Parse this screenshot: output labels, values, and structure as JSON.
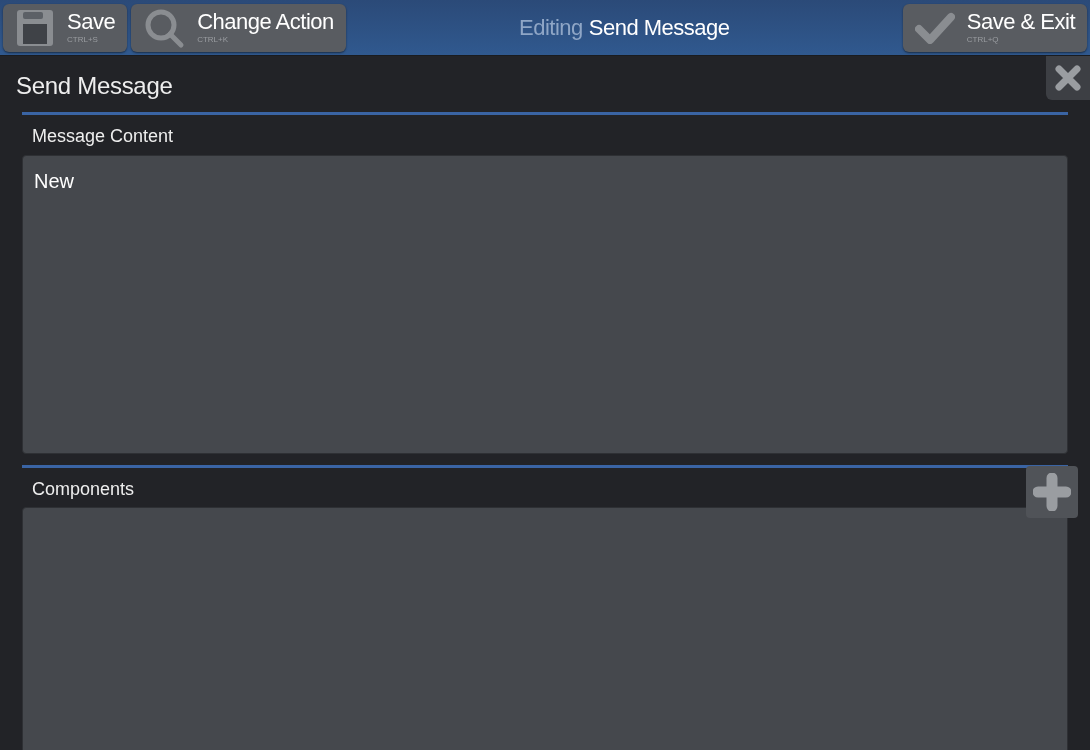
{
  "toolbar": {
    "buttons": [
      {
        "kind": "save",
        "label": "Save",
        "shortcut": "CTRL+S"
      },
      {
        "kind": "search",
        "label": "Change Action",
        "shortcut": "CTRL+K"
      }
    ],
    "title_prefix": "Editing",
    "title": "Send Message",
    "exit_button": {
      "kind": "check",
      "label": "Save & Exit",
      "shortcut": "CTRL+Q"
    }
  },
  "editor": {
    "title": "Send Message",
    "message_content": {
      "label": "Message Content",
      "value": "New"
    },
    "components": {
      "label": "Components"
    }
  }
}
